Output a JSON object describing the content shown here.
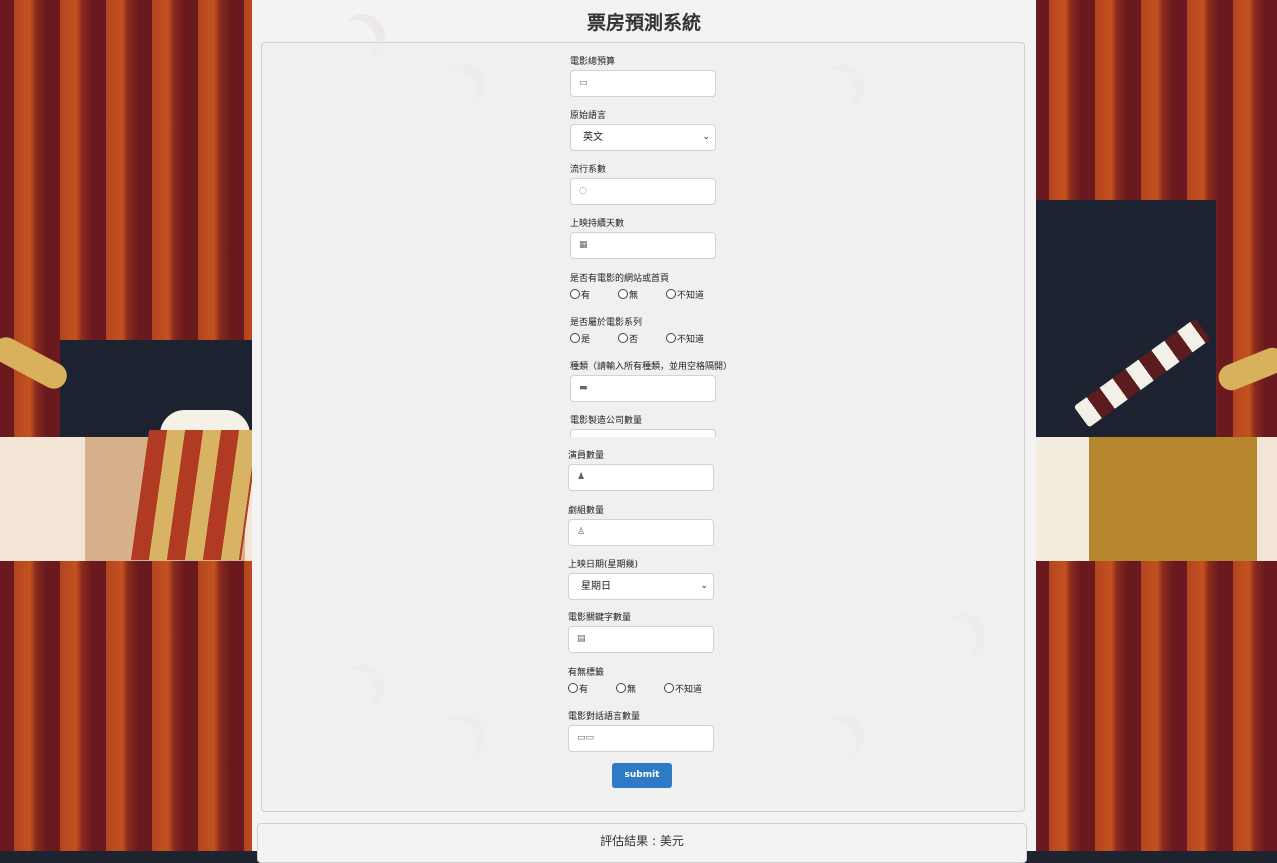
{
  "title": "票房預測系統",
  "fields": [
    {
      "key": "budget",
      "label": "電影總預算",
      "type": "input",
      "icon": "money-icon",
      "glyph": "▭"
    },
    {
      "key": "language",
      "label": "原始語言",
      "type": "select",
      "value": "英文"
    },
    {
      "key": "popularity",
      "label": "流行系數",
      "type": "input",
      "icon": "comment-icon",
      "glyph": "◌"
    },
    {
      "key": "runtime_days",
      "label": "上映持續天數",
      "type": "input",
      "icon": "calendar-icon",
      "glyph": "▦"
    },
    {
      "key": "homepage",
      "label": "是否有電影的網站或首頁",
      "type": "radio",
      "options": [
        "有",
        "無",
        "不知道"
      ]
    },
    {
      "key": "collection",
      "label": "是否屬於電影系列",
      "type": "radio",
      "options": [
        "是",
        "否",
        "不知道"
      ]
    },
    {
      "key": "genres",
      "label": "種類（請輸入所有種類，並用空格隔開）",
      "type": "input",
      "icon": "folder-icon",
      "glyph": "▬"
    },
    {
      "key": "companies",
      "label": "電影製造公司數量",
      "type": "input",
      "icon": "building-icon",
      "glyph": ""
    },
    {
      "key": "cast",
      "label": "演員數量",
      "type": "input",
      "icon": "person-icon",
      "glyph": "♟"
    },
    {
      "key": "crew",
      "label": "劇組數量",
      "type": "input",
      "icon": "user-tie-icon",
      "glyph": "♙"
    },
    {
      "key": "release_weekday",
      "label": "上映日期(星期幾)",
      "type": "select",
      "value": "星期日"
    },
    {
      "key": "keywords",
      "label": "電影關鍵字數量",
      "type": "input",
      "icon": "file-icon",
      "glyph": "▤"
    },
    {
      "key": "tagline",
      "label": "有無標籤",
      "type": "radio",
      "options": [
        "有",
        "無",
        "不知道"
      ]
    },
    {
      "key": "spoken_languages",
      "label": "電影對話語言數量",
      "type": "input",
      "icon": "language-icon",
      "glyph": "▭▭"
    }
  ],
  "submit_label": "submit",
  "result": {
    "text": "評估結果 : 美元"
  },
  "colors": {
    "accent": "#2f7ac4",
    "curtain": "#b4441f"
  }
}
